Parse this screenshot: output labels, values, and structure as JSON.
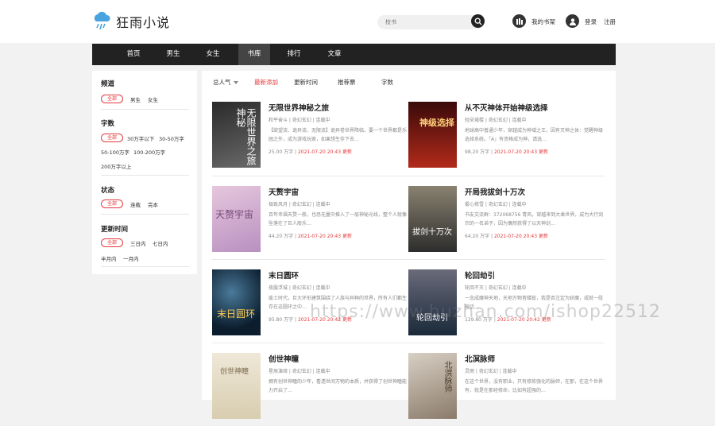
{
  "header": {
    "logo_text": "狂雨小说",
    "search_placeholder": "校书",
    "shelf": "我的书架",
    "login": "登录",
    "register": "注册"
  },
  "nav": [
    "首页",
    "男生",
    "女生",
    "书库",
    "排行",
    "文章"
  ],
  "nav_active": "书库",
  "filters": {
    "channel": {
      "title": "频道",
      "all": "全部",
      "options": [
        "男生",
        "女生"
      ]
    },
    "words": {
      "title": "字数",
      "all": "全部",
      "options": [
        "30万字以下",
        "30-50万字",
        "50-100万字",
        "100-200万字",
        "200万字以上"
      ]
    },
    "status": {
      "title": "状态",
      "all": "全部",
      "options": [
        "连载",
        "完本"
      ]
    },
    "update": {
      "title": "更新时间",
      "all": "全部",
      "options": [
        "三日内",
        "七日内",
        "半月内",
        "一月内"
      ]
    }
  },
  "sort": [
    "总人气",
    "最新添加",
    "更新时间",
    "推荐票",
    "字数"
  ],
  "books": [
    {
      "title": "无限世界神秘之旅",
      "meta": "和平奋斗 | 奇幻玄幻 | 连载中",
      "desc": "【欲望流、诡异流、无限流】诡异卷世界降临，要一个世界都是乐园之外，成为游戏玩家，如果想生存下去…",
      "words": "25.00 万字",
      "time": "2021-07-20 20:43",
      "tag": "更新",
      "cover_text": "无限世界之旅 神秘",
      "cover_colors": [
        "#2a2a2a",
        "#6b6b6b"
      ]
    },
    {
      "title": "从不灭神体开始神级选择",
      "meta": "轻朵城楼 | 奇幻玄幻 | 连载中",
      "desc": "地球高中普通少年，穿越成为神域之王，因有灭神之体：觉醒神级选择系统。「A」有资格成为神，请选…",
      "words": "98.20 万字",
      "time": "2021-07-20 20:43",
      "tag": "更新",
      "cover_text": "神级选择",
      "cover_colors": [
        "#3a0a0a",
        "#b22a1a"
      ]
    },
    {
      "title": "天赘宇宙",
      "meta": "极致风月 | 奇幻玄幻 | 连载中",
      "desc": "百年幸福天赘一般，也恐无量中推入了一层神秘光线，整个人就像坠落在了巨人般乐…",
      "words": "44.20 万字",
      "time": "2021-07-20 20:43",
      "tag": "更新",
      "cover_text": "天赘宇宙",
      "cover_colors": [
        "#e6c7dd",
        "#b890c0"
      ]
    },
    {
      "title": "开局我拔剑十万次",
      "meta": "雾心修雪 | 奇幻玄幻 | 连载中",
      "desc": "书友交流群：372068756 青风，穿越来到大乘世界，成为大行剑宗的一名弟子，因为偶然获得了以天神剑…",
      "words": "64.20 万字",
      "time": "2021-07-20 20:43",
      "tag": "更新",
      "cover_text": "拔剑十万次",
      "cover_colors": [
        "#2d2d2d",
        "#8a8270"
      ]
    },
    {
      "title": "末日圆环",
      "meta": "夜蜃浮城 | 奇幻玄幻 | 连载中",
      "desc": "废土时代，巨大环形建筑围绕了人族与异种的世界，所有人们都生存在这圆环之中…",
      "words": "95.80 万字",
      "time": "2021-07-20 20:42",
      "tag": "更新",
      "cover_text": "末日圆环",
      "cover_colors": [
        "#0c1e2e",
        "#4a7a9a"
      ]
    },
    {
      "title": "轮回劫引",
      "meta": "轮回不灭 | 奇幻玄幻 | 连载中",
      "desc": "一念成魔神天地，天地万物皆蝼蚁，我是否注定为妖魔，成就一段神话…",
      "words": "129.80 万字",
      "time": "2021-07-20 20:42",
      "tag": "更新",
      "cover_text": "轮回劫引",
      "cover_colors": [
        "#1a2a3a",
        "#6a6a7a"
      ]
    },
    {
      "title": "创世神瞳",
      "meta": "星辰演绎 | 奇幻玄幻 | 连载中",
      "desc": "拥有创世神瞳的少年，看透世间万物的本质，并获得了创世神瞳能力开启了…",
      "words": "",
      "time": "",
      "tag": "",
      "cover_text": "创世神瞳",
      "cover_colors": [
        "#efe8d8",
        "#d8cdb0"
      ]
    },
    {
      "title": "北溟脉师",
      "meta": "灵雨 | 奇幻玄幻 | 连载中",
      "desc": "在这个世界，没有职业，只有修炼强化的脉师，在那，在这个世界有，就是在那经修命，比如有超强的…",
      "words": "",
      "time": "",
      "tag": "",
      "cover_text": "北溟脉师",
      "cover_colors": [
        "#d8d0c4",
        "#8a7a6a"
      ]
    }
  ],
  "watermark": "https://www.huzhan.com/ishop22512"
}
